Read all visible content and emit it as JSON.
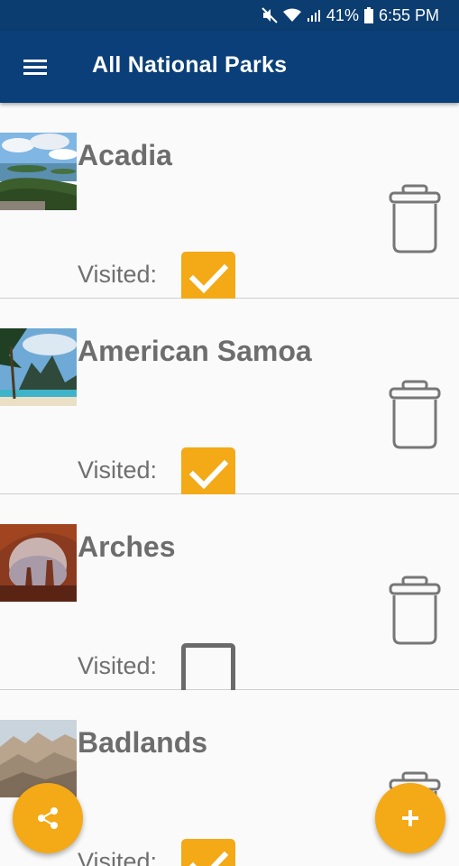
{
  "status_bar": {
    "battery": "41%",
    "time": "6:55 PM",
    "icons": [
      "mute-icon",
      "wifi-icon",
      "signal-icon",
      "battery-icon"
    ]
  },
  "app_bar": {
    "title": "All National Parks",
    "menu_icon": "hamburger-menu-icon"
  },
  "parks": [
    {
      "name": "Acadia",
      "visited_label": "Visited:",
      "visited": true
    },
    {
      "name": "American Samoa",
      "visited_label": "Visited:",
      "visited": true
    },
    {
      "name": "Arches",
      "visited_label": "Visited:",
      "visited": false
    },
    {
      "name": "Badlands",
      "visited_label": "Visited:",
      "visited": true
    }
  ],
  "fabs": {
    "share_icon": "share-icon",
    "add_icon": "plus-icon"
  },
  "colors": {
    "app_bar": "#0b3f79",
    "status_bar": "#0b3d70",
    "accent": "#f4a917",
    "text_gray": "#6d6d6d"
  }
}
